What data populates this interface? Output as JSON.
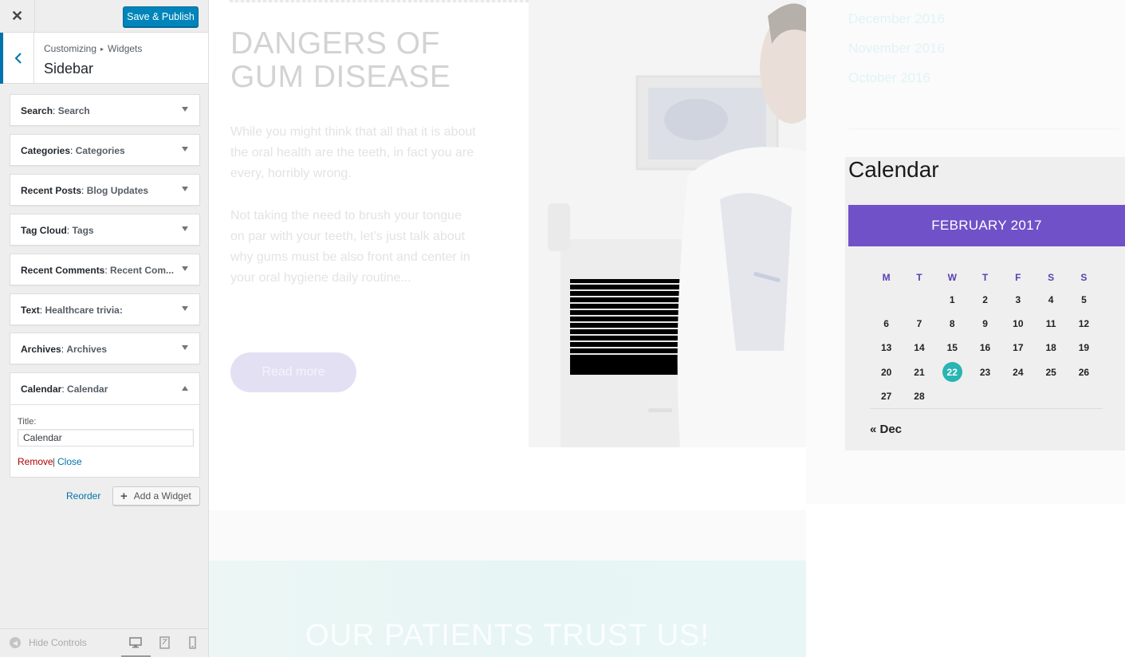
{
  "header": {
    "close_glyph": "✕",
    "save_label": "Save & Publish"
  },
  "section": {
    "breadcrumb_root": "Customizing",
    "breadcrumb_sep": "▸",
    "breadcrumb_parent": "Widgets",
    "title": "Sidebar"
  },
  "widgets": [
    {
      "type": "Search",
      "title": "Search"
    },
    {
      "type": "Categories",
      "title": "Categories"
    },
    {
      "type": "Recent Posts",
      "title": "Blog Updates"
    },
    {
      "type": "Tag Cloud",
      "title": "Tags"
    },
    {
      "type": "Recent Comments",
      "title": "Recent Com..."
    },
    {
      "type": "Text",
      "title": "Healthcare trivia:"
    },
    {
      "type": "Archives",
      "title": "Archives"
    }
  ],
  "calendar_widget": {
    "type": "Calendar",
    "title": "Calendar",
    "field_label": "Title:",
    "field_value": "Calendar",
    "remove_label": "Remove",
    "separator": "|",
    "close_label": "Close"
  },
  "actions": {
    "reorder_label": "Reorder",
    "add_widget_label": "Add a Widget"
  },
  "footer": {
    "hide_controls_label": "Hide Controls"
  },
  "preview": {
    "post_title": "DANGERS OF GUM DISEASE",
    "para1": "While you might think that all that it is about the oral health are the teeth, in fact you are every, horribly wrong.",
    "para2": "Not taking the need to brush your tongue on par with your teeth, let’s just talk about why gums must be also front and center in your oral hygiene daily routine...",
    "read_more": "Read more",
    "trust_title": "OUR PATIENTS TRUST US!",
    "archives": [
      "December 2016",
      "November 2016",
      "October 2016"
    ]
  },
  "calendar": {
    "heading": "Calendar",
    "month": "FEBRUARY 2017",
    "weekdays": [
      "M",
      "T",
      "W",
      "T",
      "F",
      "S",
      "S"
    ],
    "weeks": [
      [
        "",
        "",
        "1",
        "2",
        "3",
        "4",
        "5"
      ],
      [
        "6",
        "7",
        "8",
        "9",
        "10",
        "11",
        "12"
      ],
      [
        "13",
        "14",
        "15",
        "16",
        "17",
        "18",
        "19"
      ],
      [
        "20",
        "21",
        "22",
        "23",
        "24",
        "25",
        "26"
      ],
      [
        "27",
        "28",
        "",
        "",
        "",
        "",
        ""
      ]
    ],
    "today": "22",
    "prev_link": "« Dec"
  },
  "colors": {
    "accent_blue": "#0085ba",
    "calendar_header": "#7051c8",
    "today_circle": "#2ab4b2",
    "remove_red": "#aa0000"
  }
}
